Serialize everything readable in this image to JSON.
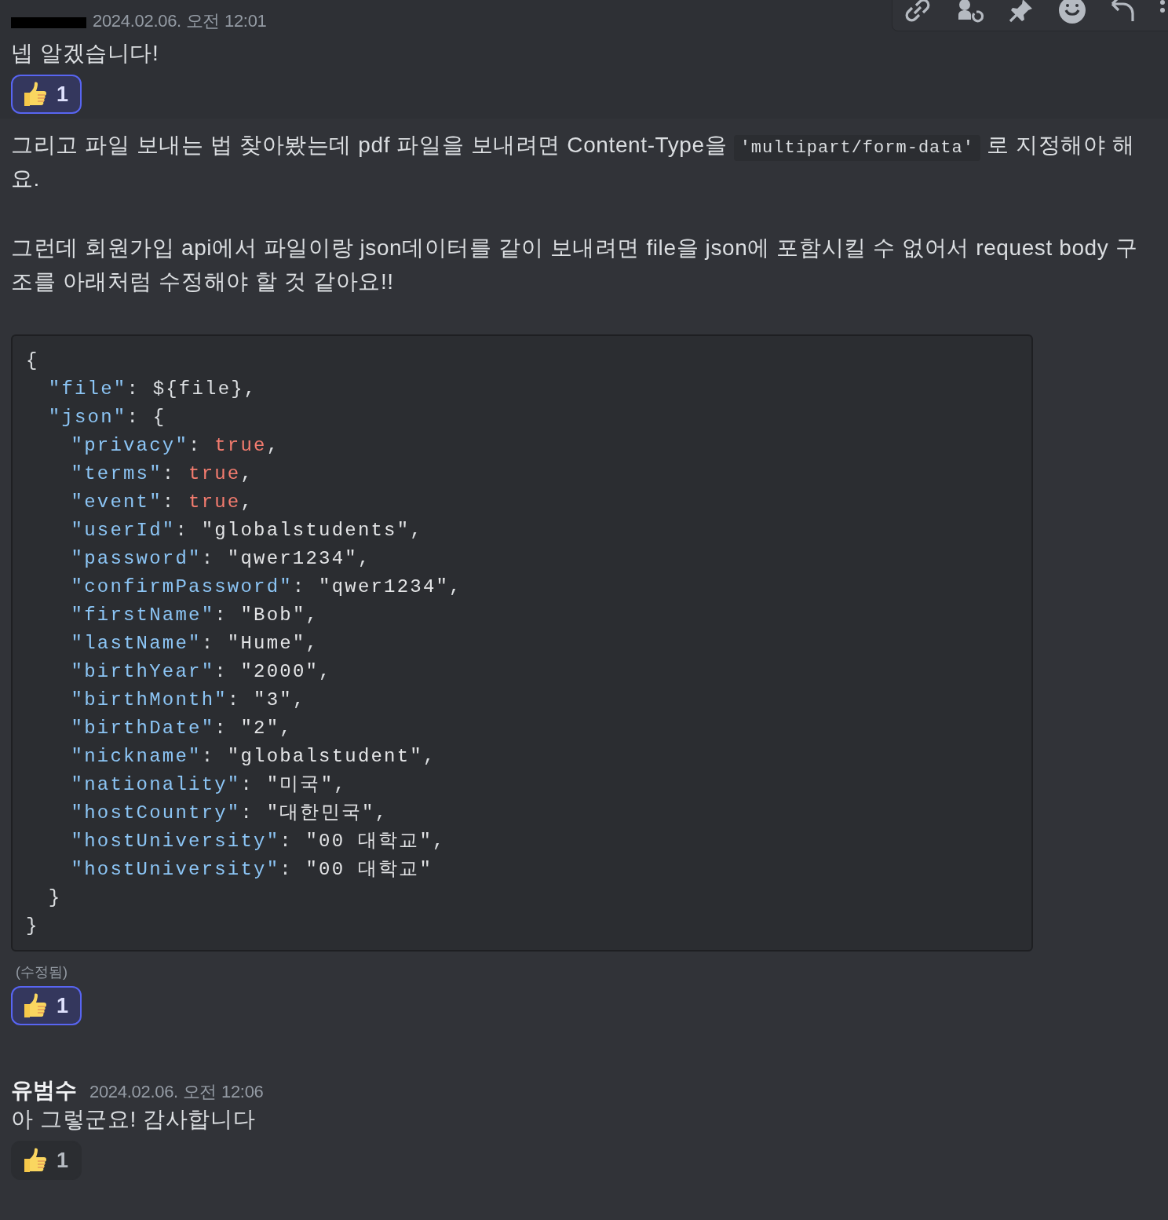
{
  "messages": [
    {
      "hovered": true,
      "header": {
        "kind": "redacted",
        "timestamp": "2024.02.06. 오전 12:01"
      },
      "blocks": [
        {
          "kind": "paragraph",
          "parts": [
            {
              "kind": "text",
              "text": "넵 알겠습니다!"
            }
          ]
        }
      ],
      "reactions": [
        {
          "count": "1",
          "selected": true
        }
      ]
    },
    {
      "hovered": false,
      "blocks": [
        {
          "kind": "paragraph",
          "parts": [
            {
              "kind": "text",
              "text": "그리고 파일 보내는 법 찾아봤는데 pdf 파일을 보내려면 Content-Type을 "
            },
            {
              "kind": "code",
              "text": "'multipart/form-data'"
            },
            {
              "kind": "text",
              "text": " 로 지정해야 해요."
            }
          ]
        },
        {
          "kind": "paragraph",
          "parts": [
            {
              "kind": "text",
              "text": "그런데 회원가입 api에서 파일이랑 json데이터를 같이 보내려면 file을 json에 포함시킬 수 없어서 request body 구조를 아래처럼 수정해야 할 것 같아요!!"
            }
          ]
        },
        {
          "kind": "code",
          "lines": [
            {
              "tokens": [
                {
                  "kind": "punct",
                  "text": "{"
                }
              ],
              "children": [
                {
                  "tokens": [
                    {
                      "kind": "key",
                      "text": "\"file\""
                    },
                    {
                      "kind": "punct",
                      "text": ": ${file},"
                    }
                  ]
                },
                {
                  "tokens": [
                    {
                      "kind": "key",
                      "text": "\"json\""
                    },
                    {
                      "kind": "punct",
                      "text": ": {"
                    }
                  ],
                  "children": [
                    {
                      "tokens": [
                        {
                          "kind": "key",
                          "text": "\"privacy\""
                        },
                        {
                          "kind": "punct",
                          "text": ": "
                        },
                        {
                          "kind": "bool",
                          "text": "true"
                        },
                        {
                          "kind": "punct",
                          "text": ","
                        }
                      ]
                    },
                    {
                      "tokens": [
                        {
                          "kind": "key",
                          "text": "\"terms\""
                        },
                        {
                          "kind": "punct",
                          "text": ": "
                        },
                        {
                          "kind": "bool",
                          "text": "true"
                        },
                        {
                          "kind": "punct",
                          "text": ","
                        }
                      ]
                    },
                    {
                      "tokens": [
                        {
                          "kind": "key",
                          "text": "\"event\""
                        },
                        {
                          "kind": "punct",
                          "text": ": "
                        },
                        {
                          "kind": "bool",
                          "text": "true"
                        },
                        {
                          "kind": "punct",
                          "text": ","
                        }
                      ]
                    },
                    {
                      "tokens": [
                        {
                          "kind": "key",
                          "text": "\"userId\""
                        },
                        {
                          "kind": "punct",
                          "text": ": "
                        },
                        {
                          "kind": "string",
                          "text": "\"globalstudents\""
                        },
                        {
                          "kind": "punct",
                          "text": ","
                        }
                      ]
                    },
                    {
                      "tokens": [
                        {
                          "kind": "key",
                          "text": "\"password\""
                        },
                        {
                          "kind": "punct",
                          "text": ": "
                        },
                        {
                          "kind": "string",
                          "text": "\"qwer1234\""
                        },
                        {
                          "kind": "punct",
                          "text": ","
                        }
                      ]
                    },
                    {
                      "tokens": [
                        {
                          "kind": "key",
                          "text": "\"confirmPassword\""
                        },
                        {
                          "kind": "punct",
                          "text": ": "
                        },
                        {
                          "kind": "string",
                          "text": "\"qwer1234\""
                        },
                        {
                          "kind": "punct",
                          "text": ","
                        }
                      ]
                    },
                    {
                      "tokens": [
                        {
                          "kind": "key",
                          "text": "\"firstName\""
                        },
                        {
                          "kind": "punct",
                          "text": ": "
                        },
                        {
                          "kind": "string",
                          "text": "\"Bob\""
                        },
                        {
                          "kind": "punct",
                          "text": ","
                        }
                      ]
                    },
                    {
                      "tokens": [
                        {
                          "kind": "key",
                          "text": "\"lastName\""
                        },
                        {
                          "kind": "punct",
                          "text": ": "
                        },
                        {
                          "kind": "string",
                          "text": "\"Hume\""
                        },
                        {
                          "kind": "punct",
                          "text": ","
                        }
                      ]
                    },
                    {
                      "tokens": [
                        {
                          "kind": "key",
                          "text": "\"birthYear\""
                        },
                        {
                          "kind": "punct",
                          "text": ": "
                        },
                        {
                          "kind": "string",
                          "text": "\"2000\""
                        },
                        {
                          "kind": "punct",
                          "text": ","
                        }
                      ]
                    },
                    {
                      "tokens": [
                        {
                          "kind": "key",
                          "text": "\"birthMonth\""
                        },
                        {
                          "kind": "punct",
                          "text": ": "
                        },
                        {
                          "kind": "string",
                          "text": "\"3\""
                        },
                        {
                          "kind": "punct",
                          "text": ","
                        }
                      ]
                    },
                    {
                      "tokens": [
                        {
                          "kind": "key",
                          "text": "\"birthDate\""
                        },
                        {
                          "kind": "punct",
                          "text": ": "
                        },
                        {
                          "kind": "string",
                          "text": "\"2\""
                        },
                        {
                          "kind": "punct",
                          "text": ","
                        }
                      ]
                    },
                    {
                      "tokens": [
                        {
                          "kind": "key",
                          "text": "\"nickname\""
                        },
                        {
                          "kind": "punct",
                          "text": ": "
                        },
                        {
                          "kind": "string",
                          "text": "\"globalstudent\""
                        },
                        {
                          "kind": "punct",
                          "text": ","
                        }
                      ]
                    },
                    {
                      "tokens": [
                        {
                          "kind": "key",
                          "text": "\"nationality\""
                        },
                        {
                          "kind": "punct",
                          "text": ": "
                        },
                        {
                          "kind": "string",
                          "text": "\"미국\""
                        },
                        {
                          "kind": "punct",
                          "text": ","
                        }
                      ]
                    },
                    {
                      "tokens": [
                        {
                          "kind": "key",
                          "text": "\"hostCountry\""
                        },
                        {
                          "kind": "punct",
                          "text": ": "
                        },
                        {
                          "kind": "string",
                          "text": "\"대한민국\""
                        },
                        {
                          "kind": "punct",
                          "text": ","
                        }
                      ]
                    },
                    {
                      "tokens": [
                        {
                          "kind": "key",
                          "text": "\"hostUniversity\""
                        },
                        {
                          "kind": "punct",
                          "text": ": "
                        },
                        {
                          "kind": "string",
                          "text": "\"00 대학교\""
                        },
                        {
                          "kind": "punct",
                          "text": ","
                        }
                      ]
                    },
                    {
                      "tokens": [
                        {
                          "kind": "key",
                          "text": "\"hostUniversity\""
                        },
                        {
                          "kind": "punct",
                          "text": ": "
                        },
                        {
                          "kind": "string",
                          "text": "\"00 대학교\""
                        }
                      ]
                    }
                  ]
                },
                {
                  "tokens": [
                    {
                      "kind": "punct",
                      "text": "}"
                    }
                  ]
                }
              ]
            },
            {
              "tokens": [
                {
                  "kind": "punct",
                  "text": "}"
                }
              ]
            }
          ]
        }
      ],
      "edited": "(수정됨)",
      "reactions": [
        {
          "count": "1",
          "selected": true
        }
      ]
    },
    {
      "hovered": false,
      "header": {
        "kind": "named",
        "author": "유범수",
        "timestamp": "2024.02.06. 오전 12:06"
      },
      "blocks": [
        {
          "kind": "paragraph",
          "parts": [
            {
              "kind": "text",
              "text": "아 그렇군요! 감사합니다"
            }
          ]
        }
      ],
      "reactions": [
        {
          "count": "1",
          "selected": false
        }
      ]
    }
  ]
}
